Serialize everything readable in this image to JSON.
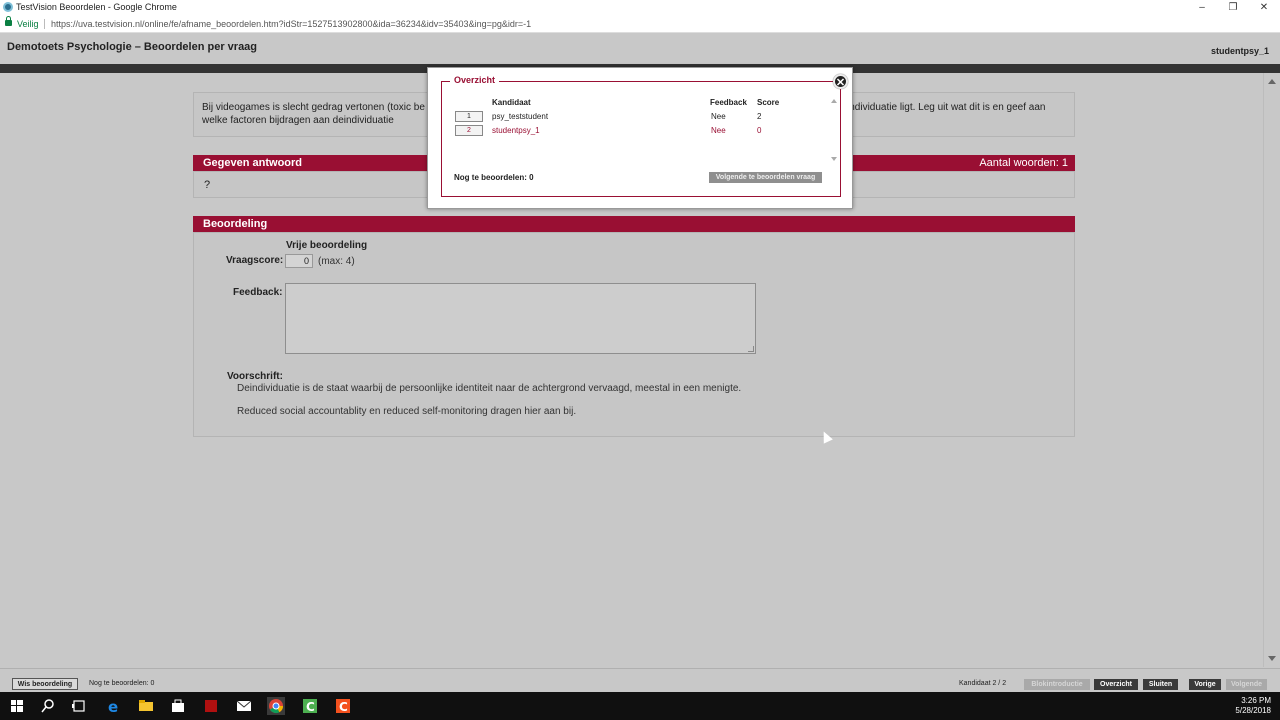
{
  "window": {
    "title": "TestVision Beoordelen - Google Chrome",
    "controls": [
      "–",
      "❐",
      "✕"
    ]
  },
  "address": {
    "secure_label": "Veilig",
    "url": "https://uva.testvision.nl/online/fe/afname_beoordelen.htm?idStr=1527513902800&ida=36234&idv=35403&ing=pg&idr=-1"
  },
  "header": {
    "title": "Demotoets Psychologie – Beoordelen per vraag",
    "user": "studentpsy_1"
  },
  "question": {
    "text_left": "Bij videogames is slecht gedrag vertonen (toxic be",
    "text_left_2": "welke factoren bijdragen aan deindividuatie",
    "text_right": "individuatie ligt. Leg uit wat dit is en geef aan"
  },
  "answer": {
    "heading": "Gegeven antwoord",
    "word_count": "Aantal woorden: 1",
    "text": "?"
  },
  "assessment": {
    "heading": "Beoordeling",
    "free_label": "Vrije beoordeling",
    "score_label": "Vraagscore:",
    "score_value": "0",
    "max_label": "(max: 4)",
    "feedback_label": "Feedback:",
    "rule_label": "Voorschrift:",
    "rule_line1": "Deindividuatie is de staat waarbij de persoonlijke identiteit naar de achtergrond vervaagd, meestal in een menigte.",
    "rule_line2": "Reduced social accountablity en reduced self-monitoring dragen hier aan bij."
  },
  "overview": {
    "legend": "Overzicht",
    "close": "✕",
    "headers": {
      "candidate": "Kandidaat",
      "feedback": "Feedback",
      "score": "Score"
    },
    "rows": [
      {
        "index": "1",
        "name": "psy_teststudent",
        "feedback": "Nee",
        "score": "2"
      },
      {
        "index": "2",
        "name": "studentpsy_1",
        "feedback": "Nee",
        "score": "0"
      }
    ],
    "remaining": "Nog te beoordelen: 0",
    "next_button": "Volgende te beoordelen vraag"
  },
  "toolbar": {
    "clear_button": "Wis beoordeling",
    "remaining": "Nog te beoordelen: 0",
    "candidate": "Kandidaat 2 / 2",
    "block_intro": "Blokintroductie",
    "overview": "Overzicht",
    "close": "Sluiten",
    "previous": "Vorige",
    "next": "Volgende"
  },
  "taskbar": {
    "time": "3:26 PM",
    "date": "5/28/2018"
  },
  "colors": {
    "accent": "#990f33",
    "secure": "#0b8043"
  }
}
